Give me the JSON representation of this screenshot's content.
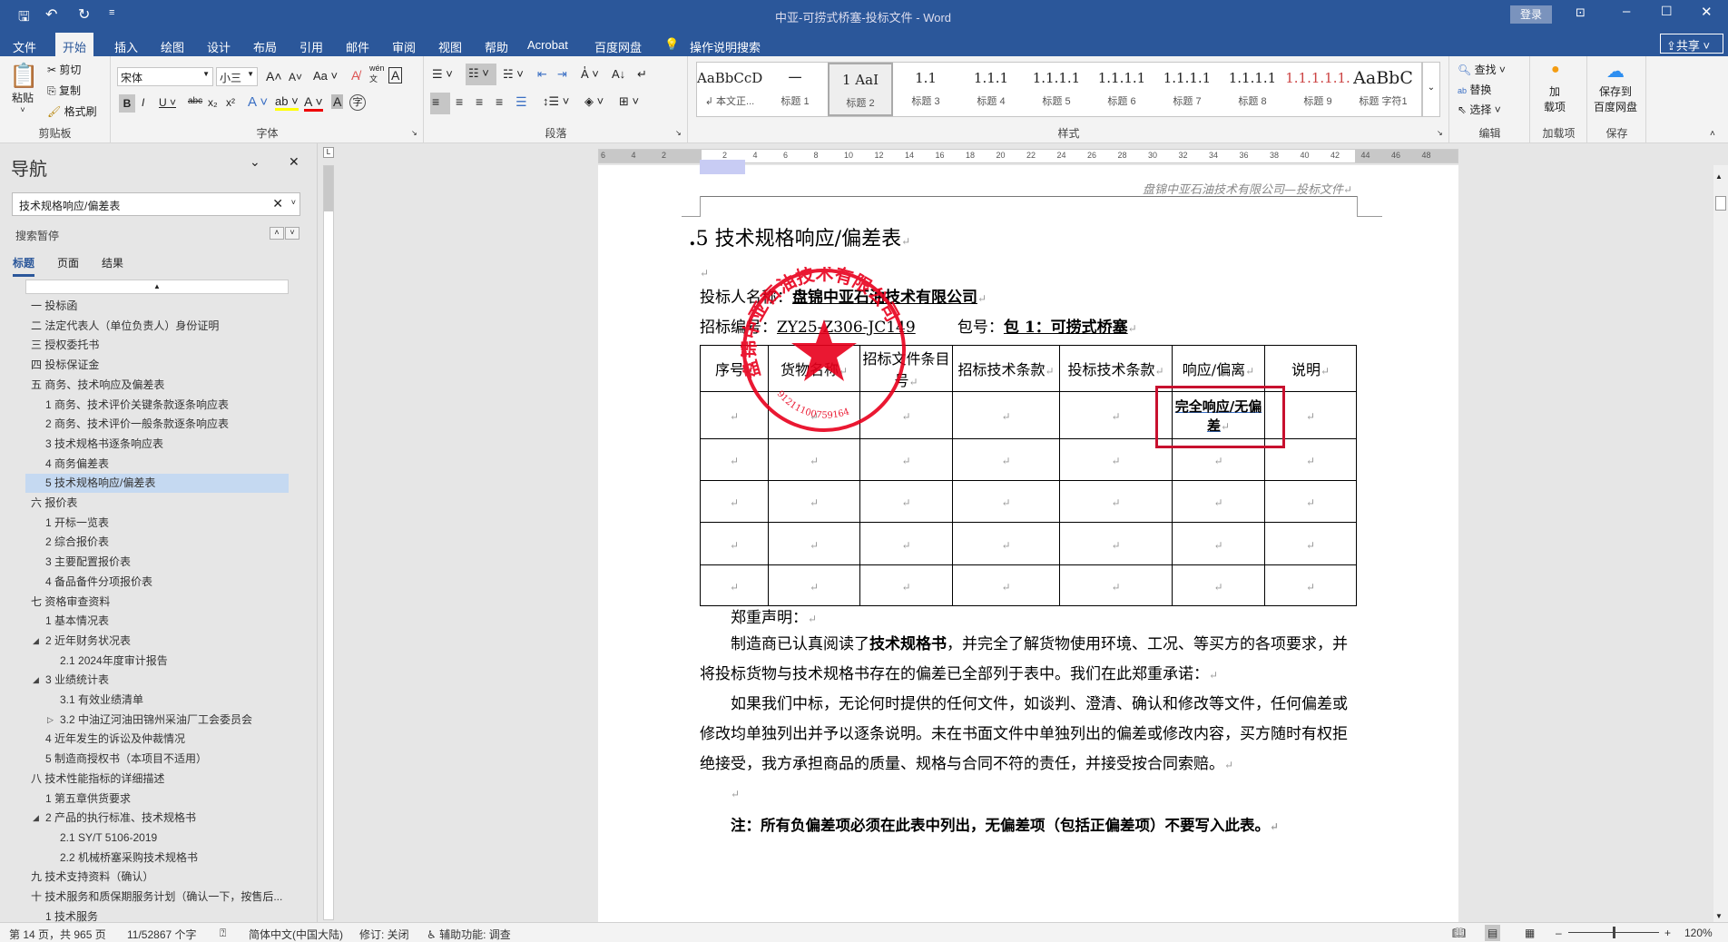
{
  "titlebar": {
    "title": "中亚-可捞式桥塞-投标文件  -  Word",
    "login": "登录",
    "share": "共享"
  },
  "tabs": [
    "文件",
    "开始",
    "插入",
    "绘图",
    "设计",
    "布局",
    "引用",
    "邮件",
    "审阅",
    "视图",
    "帮助",
    "Acrobat",
    "百度网盘"
  ],
  "tell_me": "操作说明搜索",
  "ribbon": {
    "clipboard": {
      "label": "剪贴板",
      "paste": "粘贴",
      "cut": "剪切",
      "copy": "复制",
      "format_painter": "格式刷"
    },
    "font": {
      "label": "字体",
      "font_name": "宋体",
      "font_size": "小三",
      "change_case": "Aa",
      "phonetic": "wén"
    },
    "paragraph": {
      "label": "段落"
    },
    "styles": {
      "label": "样式",
      "items": [
        {
          "preview": "AaBbCcDdE",
          "name": "↲ 本文正..."
        },
        {
          "preview": "一",
          "name": "标题 1"
        },
        {
          "preview": "1  AaI",
          "name": "标题 2"
        },
        {
          "preview": "1.1",
          "name": "标题 3"
        },
        {
          "preview": "1.1.1",
          "name": "标题 4"
        },
        {
          "preview": "1.1.1.1",
          "name": "标题 5"
        },
        {
          "preview": "1.1.1.1",
          "name": "标题 6"
        },
        {
          "preview": "1.1.1.1",
          "name": "标题 7"
        },
        {
          "preview": "1.1.1.1",
          "name": "标题 8"
        },
        {
          "preview": "1.1.1.1.1.",
          "name": "标题 9"
        },
        {
          "preview": "AaBbC",
          "name": "标题 字符1"
        }
      ]
    },
    "editing": {
      "label": "编辑",
      "find": "查找",
      "replace": "替换",
      "select": "选择"
    },
    "addins": {
      "label": "加载项",
      "button": "加\n载项"
    },
    "save": {
      "label": "保存",
      "button": "保存到\n百度网盘"
    }
  },
  "nav": {
    "title": "导航",
    "search_value": "技术规格响应/偏差表",
    "search_status": "搜索暂停",
    "tabs": [
      "标题",
      "页面",
      "结果"
    ],
    "items": [
      {
        "t": "一 投标函",
        "l": 0,
        "a": ""
      },
      {
        "t": "二 法定代表人（单位负责人）身份证明",
        "l": 0,
        "a": ""
      },
      {
        "t": "三 授权委托书",
        "l": 0,
        "a": ""
      },
      {
        "t": "四 投标保证金",
        "l": 0,
        "a": ""
      },
      {
        "t": "五 商务、技术响应及偏差表",
        "l": 0,
        "a": "open"
      },
      {
        "t": "1 商务、技术评价关键条款逐条响应表",
        "l": 1,
        "a": ""
      },
      {
        "t": "2 商务、技术评价一般条款逐条响应表",
        "l": 1,
        "a": ""
      },
      {
        "t": "3 技术规格书逐条响应表",
        "l": 1,
        "a": ""
      },
      {
        "t": "4 商务偏差表",
        "l": 1,
        "a": ""
      },
      {
        "t": "5 技术规格响应/偏差表",
        "l": 1,
        "a": "",
        "sel": true
      },
      {
        "t": "六 报价表",
        "l": 0,
        "a": "open"
      },
      {
        "t": "1 开标一览表",
        "l": 1,
        "a": ""
      },
      {
        "t": "2 综合报价表",
        "l": 1,
        "a": ""
      },
      {
        "t": "3 主要配置报价表",
        "l": 1,
        "a": ""
      },
      {
        "t": "4 备品备件分项报价表",
        "l": 1,
        "a": ""
      },
      {
        "t": "七 资格审查资料",
        "l": 0,
        "a": "open"
      },
      {
        "t": "1 基本情况表",
        "l": 1,
        "a": ""
      },
      {
        "t": "2 近年财务状况表",
        "l": 1,
        "a": "open"
      },
      {
        "t": "2.1 2024年度审计报告",
        "l": 2,
        "a": ""
      },
      {
        "t": "3 业绩统计表",
        "l": 1,
        "a": "open"
      },
      {
        "t": "3.1 有效业绩清单",
        "l": 2,
        "a": ""
      },
      {
        "t": "3.2 中油辽河油田锦州采油厂工会委员会",
        "l": 2,
        "a": "closed"
      },
      {
        "t": "4 近年发生的诉讼及仲裁情况",
        "l": 1,
        "a": ""
      },
      {
        "t": "5 制造商授权书（本项目不适用）",
        "l": 1,
        "a": ""
      },
      {
        "t": "八 技术性能指标的详细描述",
        "l": 0,
        "a": "open"
      },
      {
        "t": "1 第五章供货要求",
        "l": 1,
        "a": ""
      },
      {
        "t": "2 产品的执行标准、技术规格书",
        "l": 1,
        "a": "open"
      },
      {
        "t": "2.1 SY/T 5106-2019",
        "l": 2,
        "a": ""
      },
      {
        "t": "2.2 机械桥塞采购技术规格书",
        "l": 2,
        "a": ""
      },
      {
        "t": "九 技术支持资料（确认）",
        "l": 0,
        "a": ""
      },
      {
        "t": "十 技术服务和质保期服务计划（确认一下，按售后...",
        "l": 0,
        "a": "open"
      },
      {
        "t": "1 技术服务",
        "l": 1,
        "a": ""
      }
    ]
  },
  "ruler": [
    "6",
    "4",
    "2",
    "",
    "2",
    "4",
    "6",
    "8",
    "10",
    "12",
    "14",
    "16",
    "18",
    "20",
    "22",
    "24",
    "26",
    "28",
    "30",
    "32",
    "34",
    "36",
    "38",
    "40",
    "42",
    "44",
    "46",
    "48"
  ],
  "doc": {
    "header": "盘锦中亚石油技术有限公司—投标文件",
    "heading": "5 技术规格响应/偏差表",
    "bidder_label": "投标人名称：",
    "bidder": "盘锦中亚石油技术有限公司",
    "tender_no_label": "招标编号：",
    "tender_no": "ZY25-Z306-JC149",
    "package_label": "包号：",
    "package": "包 1：可捞式桥塞",
    "table_headers": [
      "序号",
      "货物名称",
      "招标文件条目号",
      "招标技术条款",
      "投标技术条款",
      "响应/偏离",
      "说明"
    ],
    "response_value": "完全响应/无偏差",
    "declaration_title": "郑重声明：",
    "para1_a": "制造商已认真阅读了",
    "para1_bold": "技术规格书",
    "para1_b": "，并完全了解货物使用环境、工况、等买方的各项要求，并将投标货物与技术规格书存在的偏差已全部列于表中。我们在此郑重承诺：",
    "para2": "如果我们中标，无论何时提供的任何文件，如谈判、澄清、确认和修改等文件，任何偏差或修改均单独列出并予以逐条说明。未在书面文件中单独列出的偏差或修改内容，买方随时有权拒绝接受，我方承担商品的质量、规格与合同不符的责任，并接受按合同索赔。",
    "note": "注：所有负偏差项必须在此表中列出，无偏差项（包括正偏差项）不要写入此表。",
    "stamp_text": "盘锦中亚石油技术有限公司",
    "stamp_number": "91211100759164"
  },
  "status": {
    "page": "第 14 页，共 965 页",
    "words": "11/52867 个字",
    "language": "简体中文(中国大陆)",
    "track": "修订: 关闭",
    "accessibility": "辅助功能: 调查",
    "zoom": "120%"
  },
  "colors": {
    "brand": "#2b579a",
    "highlight_box": "#c8102e",
    "stamp": "#e8001c"
  }
}
